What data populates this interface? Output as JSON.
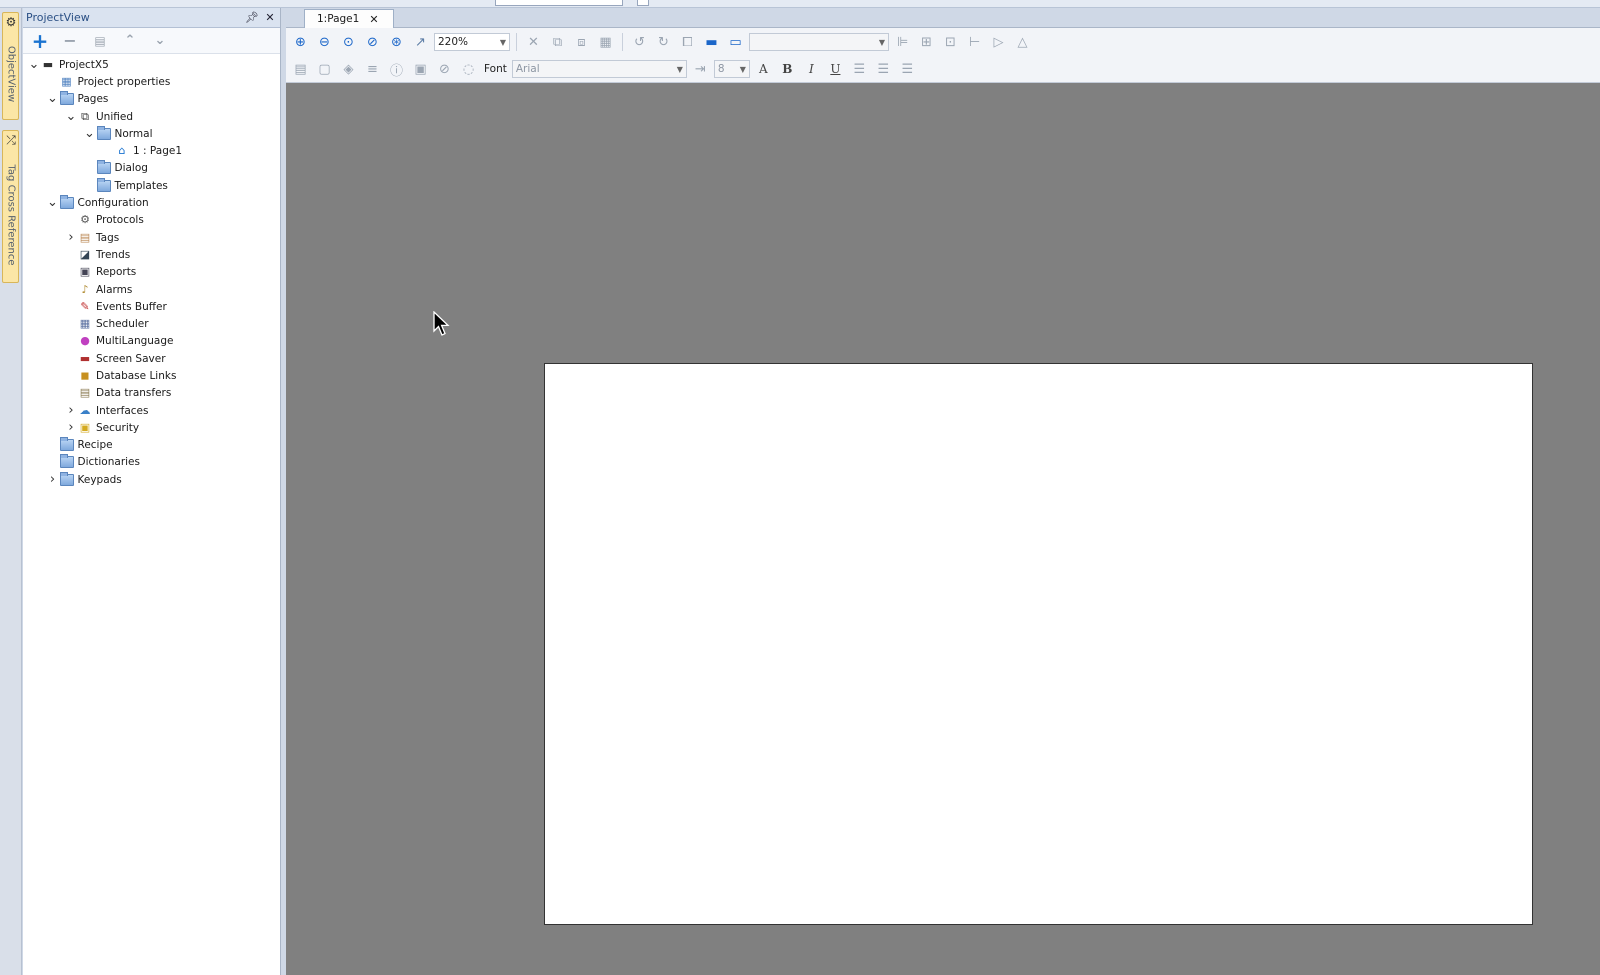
{
  "project_view": {
    "title": "ProjectView",
    "pin_icon": "pin-icon",
    "close_icon": "close-icon"
  },
  "dock_tabs": [
    "ObjectView",
    "Tag Cross Reference"
  ],
  "tree": [
    {
      "label": "ProjectX5",
      "level": 0,
      "expander": "expanded",
      "icon": "monitor"
    },
    {
      "label": "Project properties",
      "level": 1,
      "expander": "none",
      "icon": "properties"
    },
    {
      "label": "Pages",
      "level": 1,
      "expander": "expanded",
      "icon": "folder"
    },
    {
      "label": "Unified",
      "level": 2,
      "expander": "expanded",
      "icon": "unified"
    },
    {
      "label": "Normal",
      "level": 3,
      "expander": "expanded",
      "icon": "folder"
    },
    {
      "label": "1 : Page1",
      "level": 4,
      "expander": "none",
      "icon": "home"
    },
    {
      "label": "Dialog",
      "level": 3,
      "expander": "none",
      "icon": "folder"
    },
    {
      "label": "Templates",
      "level": 3,
      "expander": "none",
      "icon": "folder"
    },
    {
      "label": "Configuration",
      "level": 1,
      "expander": "expanded",
      "icon": "folder"
    },
    {
      "label": "Protocols",
      "level": 2,
      "expander": "none",
      "icon": "protocols"
    },
    {
      "label": "Tags",
      "level": 2,
      "expander": "collapsed",
      "icon": "tags"
    },
    {
      "label": "Trends",
      "level": 2,
      "expander": "none",
      "icon": "trends"
    },
    {
      "label": "Reports",
      "level": 2,
      "expander": "none",
      "icon": "printer"
    },
    {
      "label": "Alarms",
      "level": 2,
      "expander": "none",
      "icon": "bell"
    },
    {
      "label": "Events Buffer",
      "level": 2,
      "expander": "none",
      "icon": "pin"
    },
    {
      "label": "Scheduler",
      "level": 2,
      "expander": "none",
      "icon": "calendar"
    },
    {
      "label": "MultiLanguage",
      "level": 2,
      "expander": "none",
      "icon": "speech"
    },
    {
      "label": "Screen Saver",
      "level": 2,
      "expander": "none",
      "icon": "screen"
    },
    {
      "label": "Database Links",
      "level": 2,
      "expander": "none",
      "icon": "database"
    },
    {
      "label": "Data transfers",
      "level": 2,
      "expander": "none",
      "icon": "transfer"
    },
    {
      "label": "Interfaces",
      "level": 2,
      "expander": "collapsed",
      "icon": "interfaces"
    },
    {
      "label": "Security",
      "level": 2,
      "expander": "collapsed",
      "icon": "lock"
    },
    {
      "label": "Recipe",
      "level": 1,
      "expander": "none",
      "icon": "folder"
    },
    {
      "label": "Dictionaries",
      "level": 1,
      "expander": "none",
      "icon": "folder"
    },
    {
      "label": "Keypads",
      "level": 1,
      "expander": "collapsed",
      "icon": "folder"
    }
  ],
  "editor": {
    "tab_label": "1:Page1",
    "zoom": "220%",
    "font_label": "Font",
    "font_value": "Arial",
    "font_size": "8"
  },
  "colors": {
    "canvas_bg": "#808080",
    "accent": "#1b66c9"
  }
}
